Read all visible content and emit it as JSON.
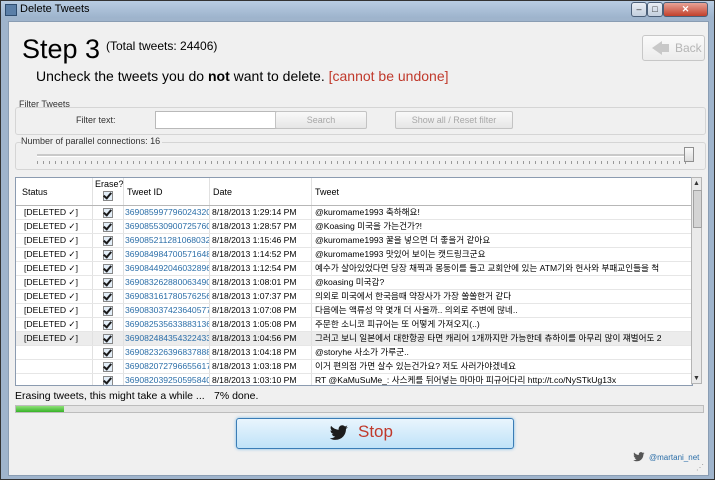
{
  "window": {
    "title": "Delete Tweets",
    "minimize": "–",
    "maximize": "□",
    "close": "✕"
  },
  "header": {
    "step": "Step 3",
    "total": "(Total tweets: 24406)",
    "back": "Back",
    "instr_pre": "Uncheck the tweets you do ",
    "instr_bold": "not",
    "instr_post": " want to delete.",
    "warning": "[cannot be undone]"
  },
  "filter": {
    "title": "Filter Tweets",
    "label": "Filter text:",
    "value": "",
    "search": "Search",
    "reset": "Show all / Reset filter"
  },
  "parallel": {
    "label": "Number of parallel connections: 16",
    "value": 16
  },
  "table": {
    "columns": {
      "status": "Status",
      "erase": "Erase?",
      "id": "Tweet ID",
      "date": "Date",
      "tweet": "Tweet"
    },
    "rows": [
      {
        "status": "[DELETED ✓]",
        "id": "369085997796024320",
        "date": "8/18/2013 1:29:14 PM",
        "tweet": "@kuromame1993 축하해요!"
      },
      {
        "status": "[DELETED ✓]",
        "id": "369085530900725760",
        "date": "8/18/2013 1:28:57 PM",
        "tweet": "@Koasing 미국을 가는건가?!"
      },
      {
        "status": "[DELETED ✓]",
        "id": "369085211281068032",
        "date": "8/18/2013 1:15:46 PM",
        "tweet": "@kuromame1993 꿀을 넣으면 더 좋을거 같아요"
      },
      {
        "status": "[DELETED ✓]",
        "id": "369084984700571648",
        "date": "8/18/2013 1:14:52 PM",
        "tweet": "@kuromame1993 맛있어 보이는 캣드링크군요"
      },
      {
        "status": "[DELETED ✓]",
        "id": "369084492046032896",
        "date": "8/18/2013 1:12:54 PM",
        "tweet": "예수가 살아있었다면 당장 채찍과 몽둥이를 들고 교회안에 있는  ATM기와 헌사와 부패교인들을 척"
      },
      {
        "status": "[DELETED ✓]",
        "id": "369083262880063490",
        "date": "8/18/2013 1:08:01 PM",
        "tweet": "@koasing 미국감?"
      },
      {
        "status": "[DELETED ✓]",
        "id": "369083161780576256",
        "date": "8/18/2013 1:07:37 PM",
        "tweet": "의외로 미국에서 한국음때 약장사가 가장 쏠쏠한거 같다"
      },
      {
        "status": "[DELETED ✓]",
        "id": "369083037423640577",
        "date": "8/18/2013 1:07:08 PM",
        "tweet": "다음에는 액류성 약 몇개 더 사올까.. 의외로 주변에 많네.."
      },
      {
        "status": "[DELETED ✓]",
        "id": "369082535633883136",
        "date": "8/18/2013 1:05:08 PM",
        "tweet": "주문한 소니코 피규어는 또 어떻게 가져오지(..)"
      },
      {
        "status": "[DELETED ✓]",
        "id": "369082484354322433",
        "date": "8/18/2013 1:04:56 PM",
        "tweet": "그러고 보니 일본에서 대한항공 타면 캐리어 1개까지만 가능한데 츄하이를 아무리 많이 쟤벌어도 2"
      },
      {
        "status": "",
        "id": "369082326396837888",
        "date": "8/18/2013 1:04:18 PM",
        "tweet": "@storyhe 사소가 가루군.."
      },
      {
        "status": "",
        "id": "369082072796655617",
        "date": "8/18/2013 1:03:18 PM",
        "tweet": "이거 편의점 가면 살수 있는건가요? 저도 사러가야겠네요"
      },
      {
        "status": "",
        "id": "369082039250595840",
        "date": "8/18/2013 1:03:10 PM",
        "tweet": "RT @KaMuSuMe_: 사스케를 뒤어넣는 마마마 피규어다리 http://t.co/NySTkUg13x"
      }
    ]
  },
  "progress": {
    "text": "Erasing tweets, this might take a while ...",
    "percent_text": "7% done.",
    "fraction": 0.07
  },
  "stop": {
    "label": "Stop"
  },
  "footer": {
    "handle": "@martani_net"
  },
  "colors": {
    "accent": "#2b6ea8",
    "warning": "#c0392b",
    "progress": "#37b327"
  }
}
